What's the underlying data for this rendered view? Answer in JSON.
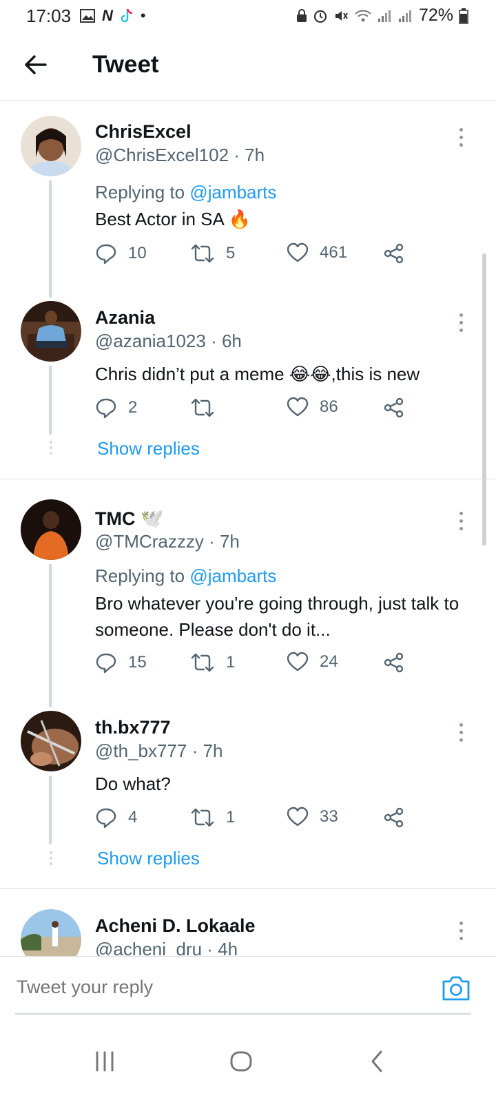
{
  "status_bar": {
    "time": "17:03",
    "battery": "72%",
    "left_icons": [
      "gallery-icon",
      "n-app-icon",
      "tiktok-icon",
      "dot-icon"
    ],
    "right_icons": [
      "lock-icon",
      "alarm-icon",
      "mute-icon",
      "wifi-icon",
      "signal-icon",
      "signal-icon",
      "battery-icon"
    ]
  },
  "header": {
    "title": "Tweet"
  },
  "tweets": [
    {
      "name": "ChrisExcel",
      "handle": "@ChrisExcel102 · 7h",
      "replying_prefix": "Replying to",
      "replying_to": "@jambarts",
      "text": "Best Actor in SA 🔥",
      "replies": "10",
      "retweets": "5",
      "likes": "461"
    },
    {
      "name": "Azania",
      "handle": "@azania1023 · 6h",
      "text": "Chris didn’t put a meme 😂😂,this is new",
      "replies": "2",
      "retweets": "",
      "likes": "86",
      "show_replies": "Show replies"
    },
    {
      "name": "TMC 🕊️",
      "handle": "@TMCrazzzy · 7h",
      "replying_prefix": "Replying to",
      "replying_to": "@jambarts",
      "text": "Bro whatever you're going through, just talk to someone. Please don't do it...",
      "replies": "15",
      "retweets": "1",
      "likes": "24"
    },
    {
      "name": "th.bx777",
      "handle": "@th_bx777 · 7h",
      "text": "Do what?",
      "replies": "4",
      "retweets": "1",
      "likes": "33",
      "show_replies": "Show replies"
    },
    {
      "name": "Acheni D. Lokaale",
      "handle": "@acheni_dru · 4h"
    }
  ],
  "reply_bar": {
    "placeholder": "Tweet your reply"
  },
  "colors": {
    "accent": "#1d9bf0",
    "secondary_text": "#536471",
    "thread_line": "#cfd9de"
  }
}
